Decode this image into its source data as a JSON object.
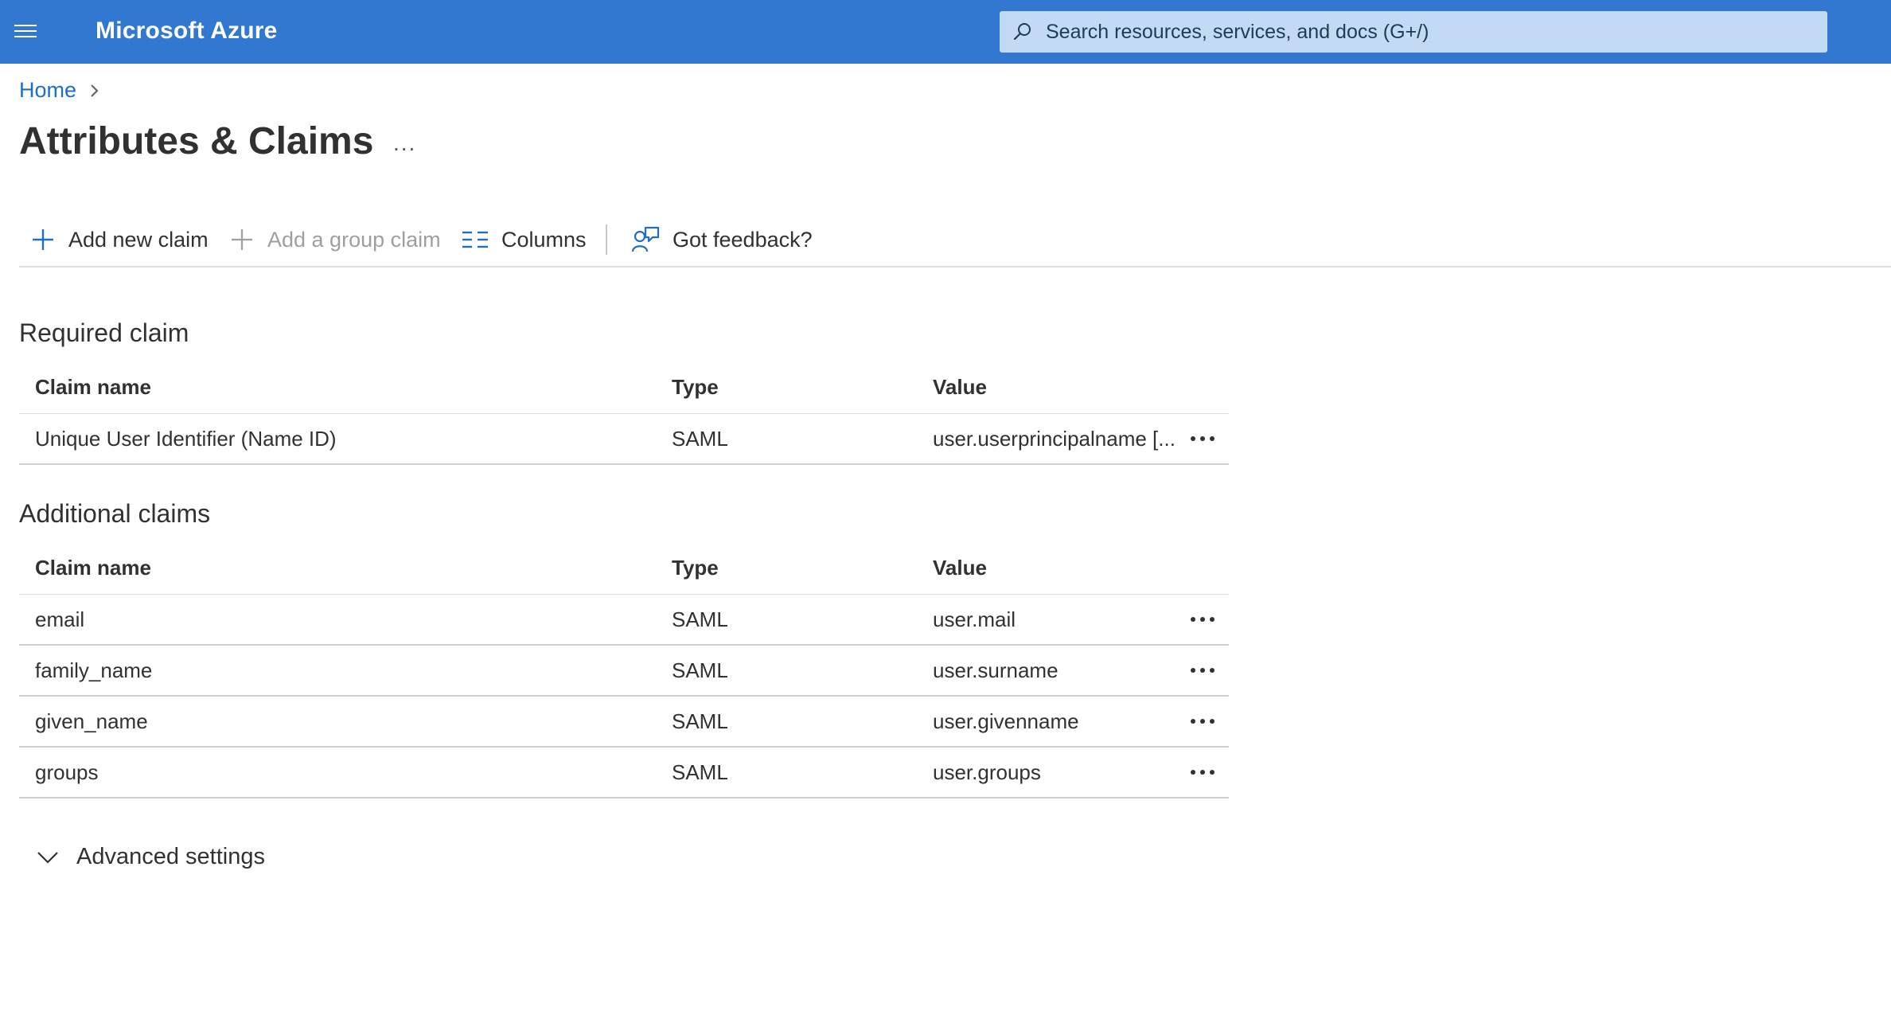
{
  "header": {
    "brand": "Microsoft Azure",
    "search_placeholder": "Search resources, services, and docs (G+/)"
  },
  "breadcrumb": {
    "items": [
      "Home"
    ]
  },
  "page": {
    "title": "Attributes & Claims",
    "more_label": "..."
  },
  "toolbar": {
    "add_new_claim": "Add new claim",
    "add_group_claim": "Add a group claim",
    "columns": "Columns",
    "feedback": "Got feedback?"
  },
  "required": {
    "title": "Required claim",
    "columns": [
      "Claim name",
      "Type",
      "Value"
    ],
    "rows": [
      {
        "name": "Unique User Identifier (Name ID)",
        "type": "SAML",
        "value": "user.userprincipalname [..."
      }
    ]
  },
  "additional": {
    "title": "Additional claims",
    "columns": [
      "Claim name",
      "Type",
      "Value"
    ],
    "rows": [
      {
        "name": "email",
        "type": "SAML",
        "value": "user.mail"
      },
      {
        "name": "family_name",
        "type": "SAML",
        "value": "user.surname"
      },
      {
        "name": "given_name",
        "type": "SAML",
        "value": "user.givenname"
      },
      {
        "name": "groups",
        "type": "SAML",
        "value": "user.groups"
      }
    ]
  },
  "advanced": {
    "label": "Advanced settings"
  },
  "colors": {
    "header_bg": "#3277d0",
    "search_bg": "#c2dbf2",
    "link": "#1f6ec5",
    "text": "#323130"
  }
}
